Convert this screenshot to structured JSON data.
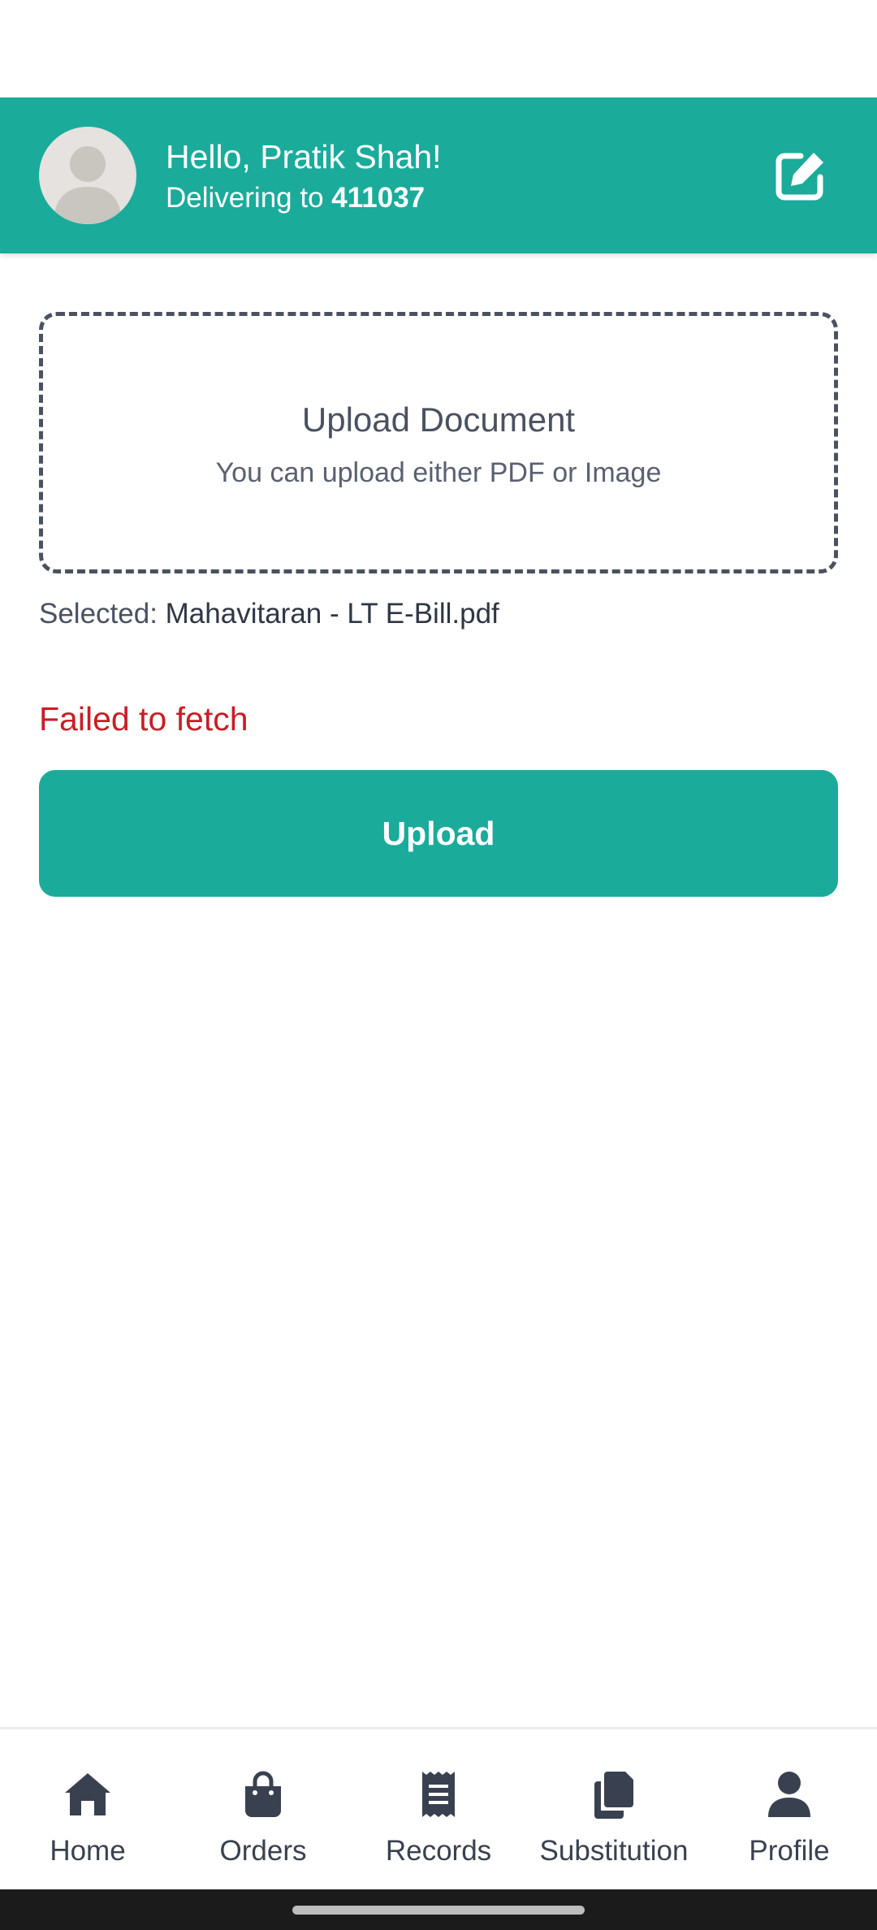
{
  "header": {
    "greeting": "Hello, Pratik Shah!",
    "delivering_prefix": "Delivering to ",
    "pincode": "411037",
    "avatar_icon": "default-user-avatar",
    "edit_icon": "edit-icon",
    "accent_color": "#1aab9b"
  },
  "upload": {
    "title": "Upload Document",
    "subtitle": "You can upload either PDF or Image",
    "selected_prefix": "Selected: ",
    "selected_file": "Mahavitaran - LT E-Bill.pdf",
    "error": "Failed to fetch",
    "error_color": "#c81e25",
    "button_label": "Upload"
  },
  "nav": {
    "items": [
      {
        "label": "Home",
        "icon": "home-icon"
      },
      {
        "label": "Orders",
        "icon": "shopping-bag-icon"
      },
      {
        "label": "Records",
        "icon": "receipt-icon"
      },
      {
        "label": "Substitution",
        "icon": "copy-icon"
      },
      {
        "label": "Profile",
        "icon": "user-icon"
      }
    ]
  }
}
